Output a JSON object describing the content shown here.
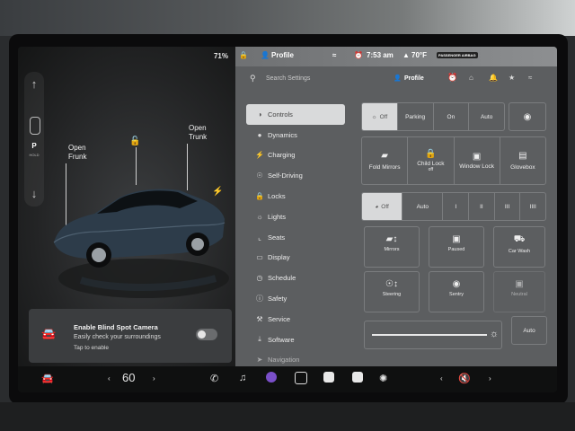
{
  "status": {
    "battery": "71%",
    "profile_top": "Profile",
    "time": "7:53 am",
    "temp": "70°F",
    "airbag": "PASSENGER AIRBAG"
  },
  "car": {
    "shifter": {
      "up_icon": "arrow-up-icon",
      "gear": "P",
      "hold": "HOLD",
      "down_icon": "arrow-down-icon"
    },
    "frunk_label": "Open\nFrunk",
    "trunk_label": "Open\nTrunk",
    "blind_spot": {
      "title": "Enable Blind Spot Camera",
      "subtitle": "Easily check your surroundings",
      "tap": "Tap to enable",
      "enabled": false
    }
  },
  "search": {
    "placeholder": "Search Settings",
    "profile": "Profile"
  },
  "menu": [
    {
      "label": "Controls",
      "icon": "toggle-icon",
      "active": true
    },
    {
      "label": "Dynamics",
      "icon": "car-icon"
    },
    {
      "label": "Charging",
      "icon": "bolt-icon"
    },
    {
      "label": "Self-Driving",
      "icon": "steering-wheel-icon"
    },
    {
      "label": "Locks",
      "icon": "lock-icon"
    },
    {
      "label": "Lights",
      "icon": "sun-icon"
    },
    {
      "label": "Seats",
      "icon": "seat-icon"
    },
    {
      "label": "Display",
      "icon": "display-icon"
    },
    {
      "label": "Schedule",
      "icon": "clock-icon"
    },
    {
      "label": "Safety",
      "icon": "info-icon"
    },
    {
      "label": "Service",
      "icon": "wrench-icon"
    },
    {
      "label": "Software",
      "icon": "download-icon"
    },
    {
      "label": "Navigation",
      "icon": "nav-icon"
    }
  ],
  "controls": {
    "lights": {
      "options": [
        "Off",
        "Parking",
        "On",
        "Auto"
      ],
      "selected": 0
    },
    "row2": [
      "Fold Mirrors",
      "Child Lock",
      "Window Lock",
      "Glovebox"
    ],
    "child_lock_sub": "off",
    "wipers": {
      "options": [
        "Off",
        "Auto",
        "I",
        "II",
        "III",
        "IIII"
      ],
      "selected": 0
    },
    "tiles": [
      {
        "label": "Mirrors",
        "icon": "mirror-adjust-icon"
      },
      {
        "label": "Paused",
        "icon": "dashcam-icon"
      },
      {
        "label": "Car Wash",
        "icon": "car-wash-icon"
      },
      {
        "label": "Steering",
        "icon": "steering-adjust-icon"
      },
      {
        "label": "Sentry",
        "icon": "sentry-icon"
      },
      {
        "label": "Neutral",
        "icon": "neutral-icon"
      }
    ],
    "brightness_auto": "Auto"
  },
  "dock": {
    "temp_value": "60"
  }
}
